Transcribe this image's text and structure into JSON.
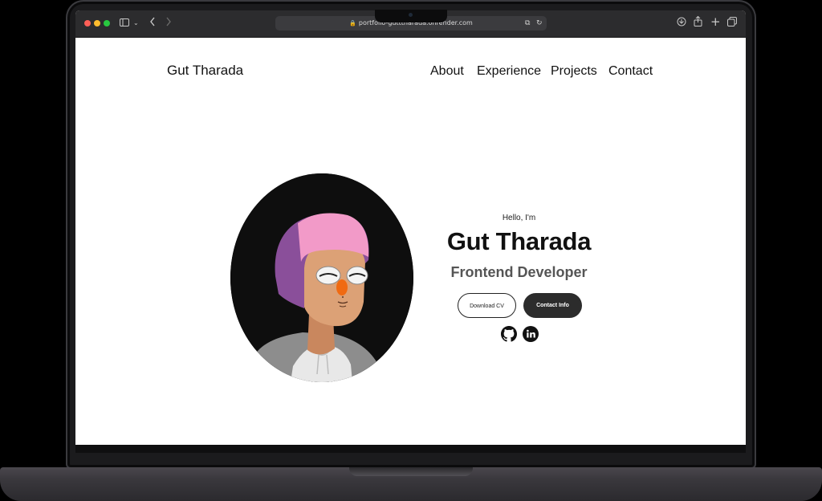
{
  "browser": {
    "url": "portfolio-gutttharada.onrender.com"
  },
  "header": {
    "brand": "Gut Tharada",
    "nav": [
      "About",
      "Experience",
      "Projects",
      "Contact"
    ]
  },
  "hero": {
    "greeting": "Hello, I'm",
    "name": "Gut Tharada",
    "role": "Frontend Developer",
    "buttons": {
      "download_cv": "Download CV",
      "contact_info": "Contact Info"
    },
    "socials": [
      "github-icon",
      "linkedin-icon"
    ]
  },
  "colors": {
    "accent_dark": "#2c2c2c",
    "avatar_bg": "#0e0e0e",
    "hair": "#f29ac8"
  }
}
